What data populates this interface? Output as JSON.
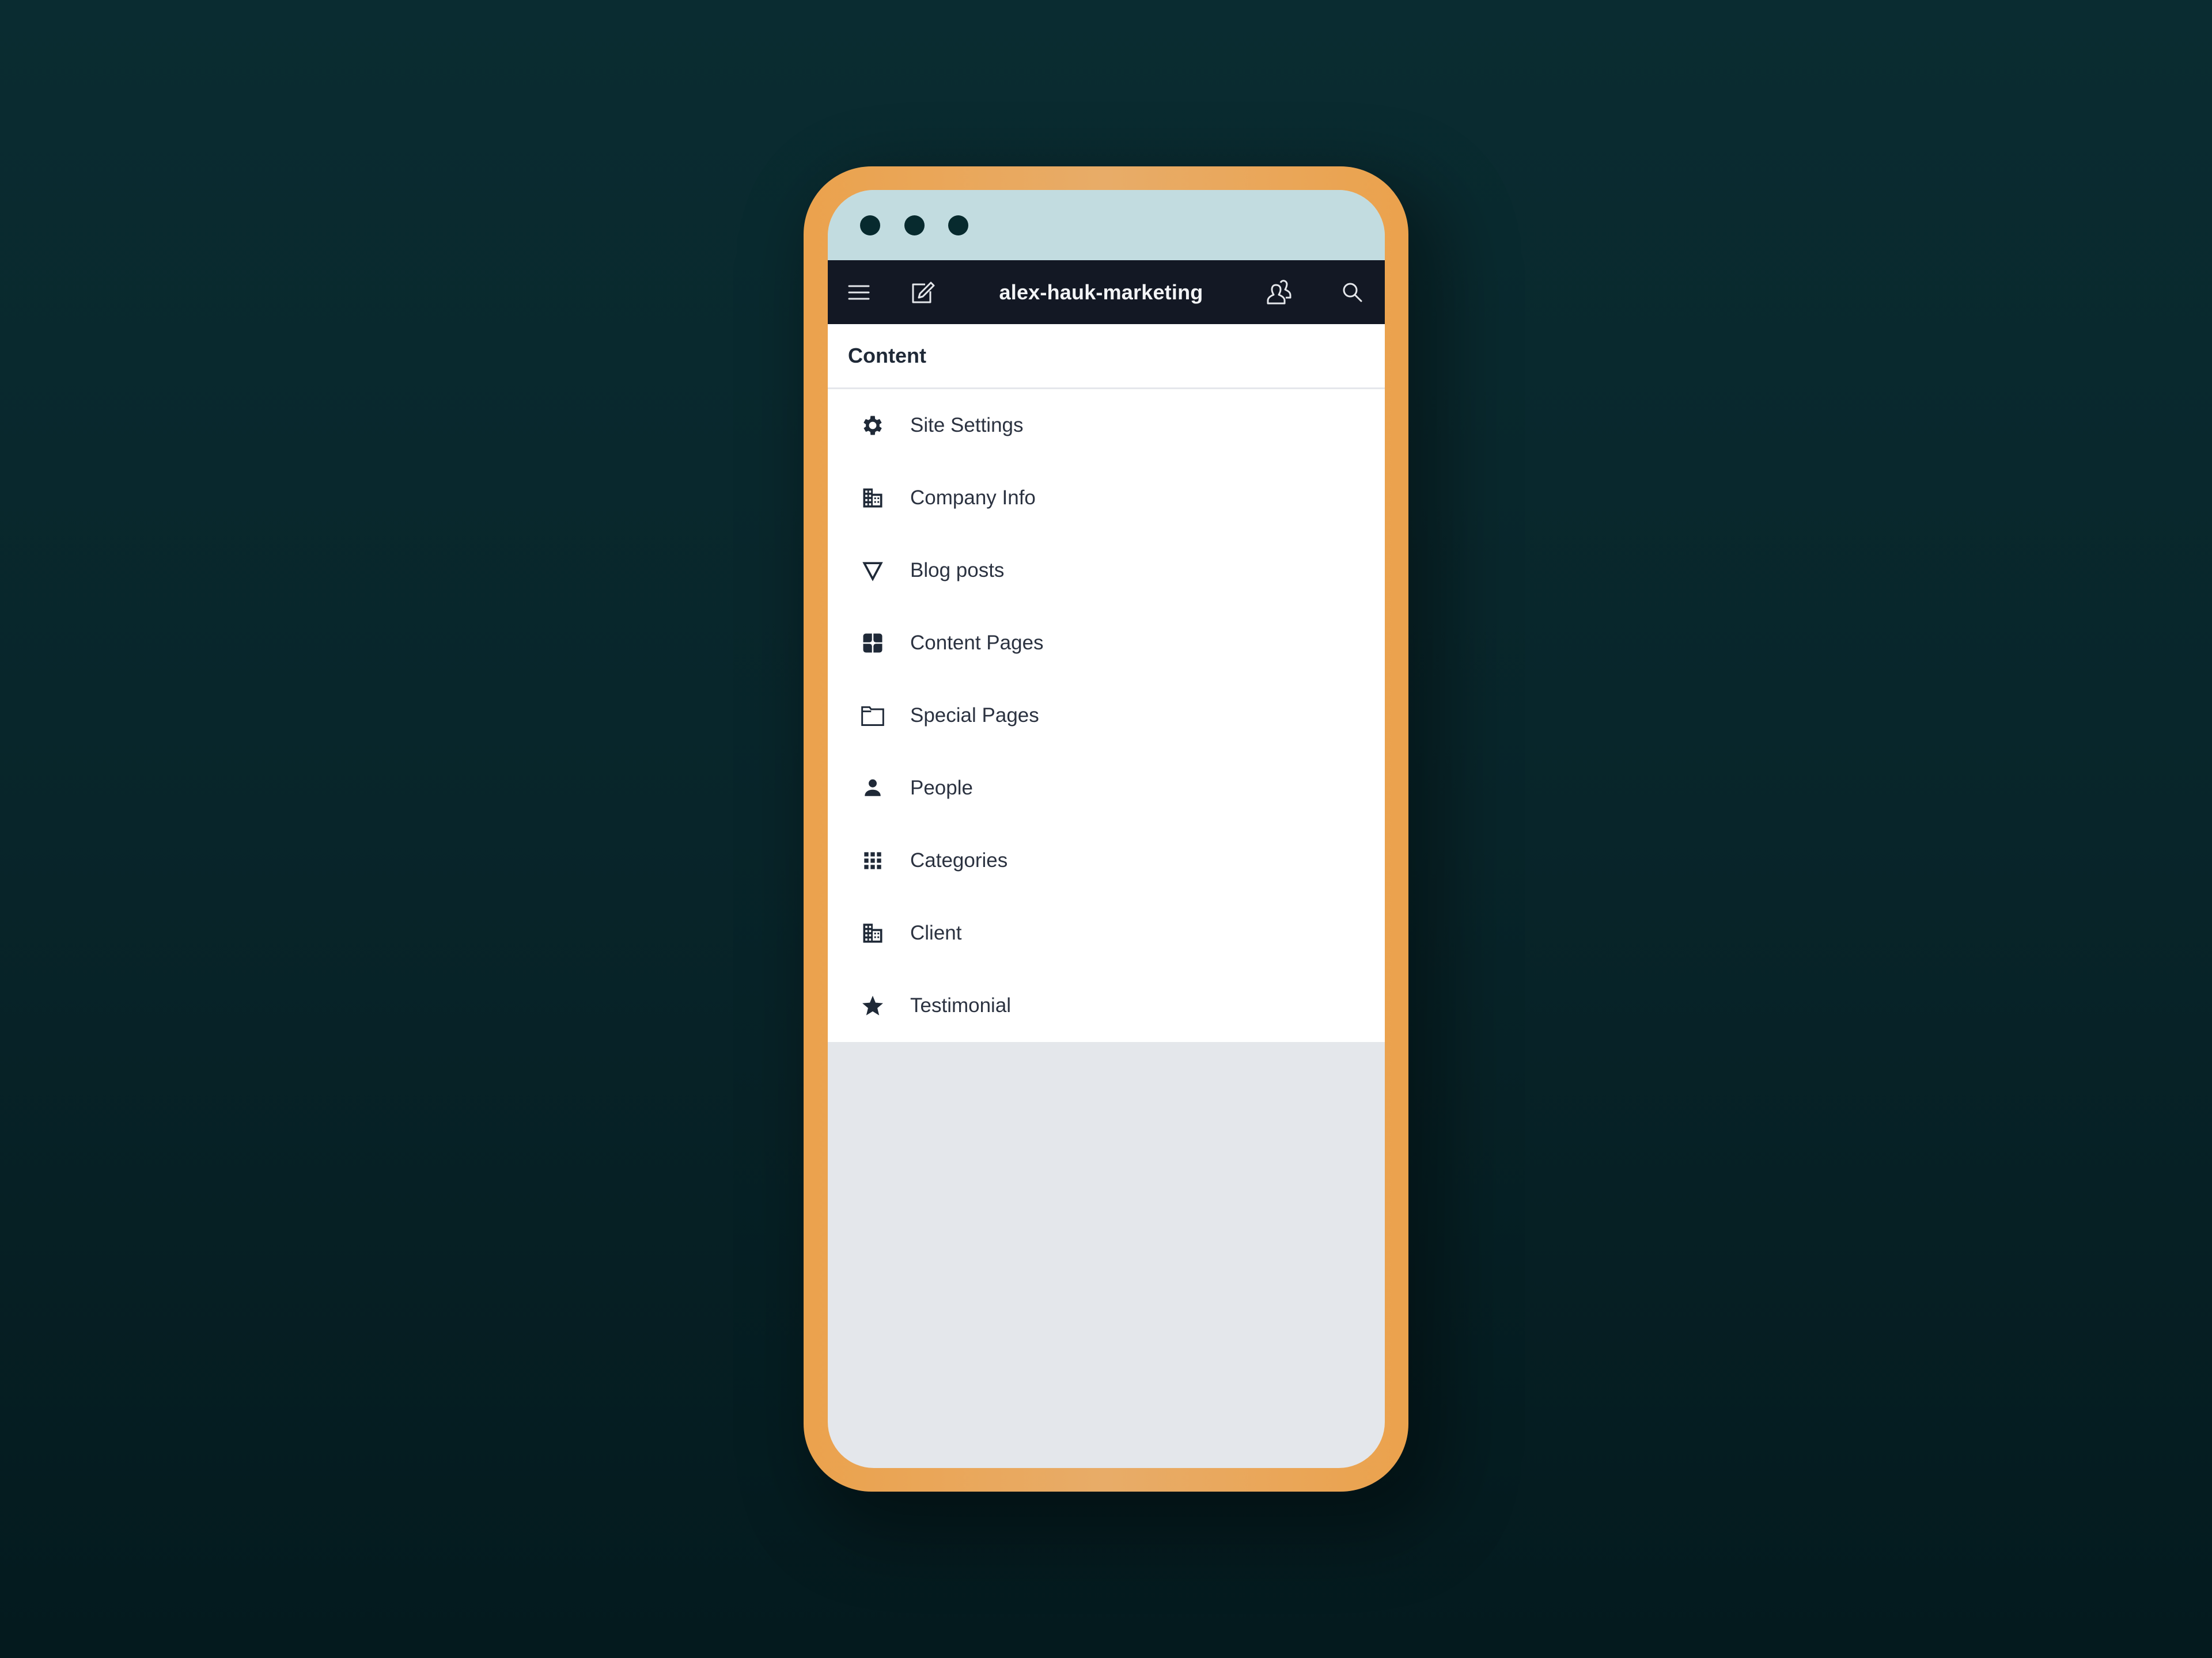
{
  "window": {
    "traffic_dots": 3
  },
  "nav": {
    "title": "alex-hauk-marketing",
    "icons": {
      "menu": "hamburger-menu-icon",
      "edit": "edit-pencil-square-icon",
      "users": "users-icon",
      "search": "search-icon"
    }
  },
  "content": {
    "heading": "Content",
    "items": [
      {
        "label": "Site Settings",
        "icon": "gear-icon"
      },
      {
        "label": "Company Info",
        "icon": "building-icon"
      },
      {
        "label": "Blog posts",
        "icon": "triangle-down-outline-icon"
      },
      {
        "label": "Content Pages",
        "icon": "expand-square-icon"
      },
      {
        "label": "Special Pages",
        "icon": "folder-outline-icon"
      },
      {
        "label": "People",
        "icon": "person-icon"
      },
      {
        "label": "Categories",
        "icon": "grid-icon"
      },
      {
        "label": "Client",
        "icon": "building-icon"
      },
      {
        "label": "Testimonial",
        "icon": "star-icon"
      }
    ]
  },
  "colors": {
    "frame": "#eba24d",
    "titlebar": "#c2dce0",
    "nav_bg": "#131824",
    "text": "#1f2937",
    "empty_area": "#e4e7eb",
    "background": "#0a2c31"
  }
}
